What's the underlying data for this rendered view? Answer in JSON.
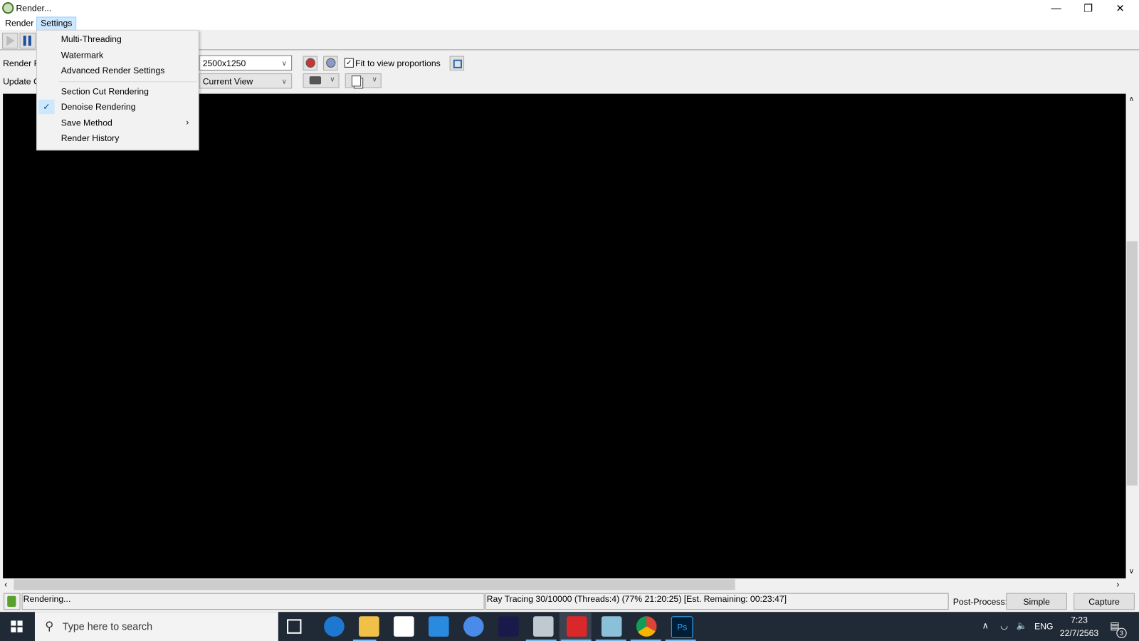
{
  "window": {
    "title": "Render...",
    "minimize": "—",
    "restore": "❐",
    "close": "✕"
  },
  "menubar": {
    "items": [
      {
        "label": "Render"
      },
      {
        "label": "Settings"
      }
    ]
  },
  "settings_menu": {
    "items": [
      {
        "label": "Multi-Threading",
        "checked": false
      },
      {
        "label": "Watermark",
        "checked": false
      },
      {
        "label": "Advanced Render Settings",
        "checked": false
      },
      {
        "label": "Section Cut Rendering",
        "checked": false
      },
      {
        "label": "Denoise Rendering",
        "checked": true
      },
      {
        "label": "Save Method",
        "submenu": true
      },
      {
        "label": "Render History",
        "checked": false
      }
    ]
  },
  "toolbar": {
    "render_preset_label": "Render P",
    "update_label": "Update C",
    "resolution": "2500x1250",
    "view": "Current View",
    "fit_to_view_label": "Fit to view proportions",
    "fit_to_view_checked": true
  },
  "status": {
    "left": "Rendering...",
    "progress": "Ray Tracing 30/10000 (Threads:4) (77% 21:20:25) [Est. Remaining: 00:23:47]",
    "post_process_label": "Post-Process:",
    "simple_button": "Simple",
    "capture_button": "Capture"
  },
  "taskbar": {
    "search_placeholder": "Type here to search",
    "language": "ENG",
    "time": "7:23",
    "date": "22/7/2563",
    "notification_count": "3"
  },
  "colors": {
    "accent": "#cce8ff",
    "taskbar": "#202a36",
    "viewport": "#000000"
  }
}
